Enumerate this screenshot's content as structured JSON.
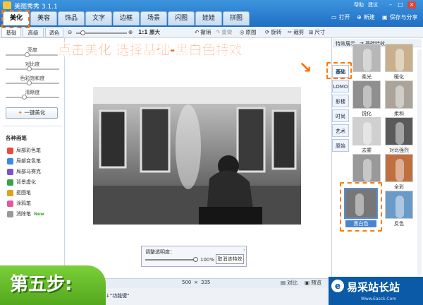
{
  "app": {
    "title": "美图秀秀 3.1.1",
    "help": "帮助",
    "feedback": "建议"
  },
  "tabs": [
    "美化",
    "美容",
    "饰品",
    "文字",
    "边框",
    "场景",
    "闪图",
    "娃娃",
    "拼图"
  ],
  "top_actions": {
    "open": "打开",
    "new": "新建",
    "save": "保存与分享"
  },
  "subtabs": [
    "基础",
    "高级",
    "调色"
  ],
  "toolbar": {
    "zoom": "1:1 原大",
    "undo": "撤销",
    "redo": "重做",
    "original": "原图",
    "rotate": "旋转",
    "crop": "裁剪",
    "size": "尺寸"
  },
  "left": {
    "sliders": [
      "亮度",
      "对比度",
      "色彩饱和度",
      "清晰度"
    ],
    "auto_button": "一键美化",
    "brush_title": "各种画笔",
    "brushes": [
      "局部彩色笔",
      "局部变色笔",
      "局部马赛克",
      "背景虚化",
      "抠图笔",
      "涂鸦笔",
      "消除笔"
    ],
    "new_badge": "New"
  },
  "annotation": "点击美化 选择基础-黑白色特效",
  "right": {
    "header_left": "特效展示",
    "header_right": "基础特效",
    "tabs": [
      "基础",
      "LOMO",
      "影楼",
      "时尚",
      "艺术",
      "原始"
    ],
    "effects": [
      "柔光",
      "暖化",
      "锐化",
      "柔和",
      "去雾",
      "对比强烈",
      "",
      "全彩",
      "黑白色",
      "反色"
    ]
  },
  "opacity": {
    "label": "调整透明度：",
    "value": "100%",
    "cancel": "取消该特效"
  },
  "status": {
    "size_w": "500",
    "times": "×",
    "size_h": "335",
    "compare": "对比",
    "preview": "预览"
  },
  "bottom": {
    "hint": "↓\"功能键\""
  },
  "step": "第五步:",
  "logo": {
    "text": "易采站长站",
    "url": "Www.Easck.Com"
  },
  "colors": {
    "accent": "#ff5a00",
    "brand": "#1f6fc3",
    "step_green": "#5db226"
  }
}
